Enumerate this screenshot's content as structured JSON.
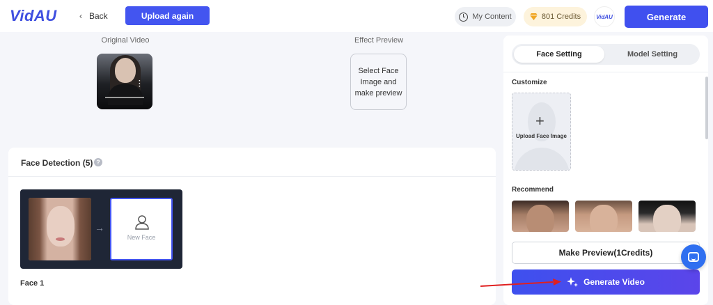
{
  "header": {
    "logo": "VidAU",
    "back_label": "Back",
    "upload_again_label": "Upload again",
    "my_content_label": "My Content",
    "credits_label": "801 Credits",
    "avatar_label": "VidAU",
    "generate_label": "Generate"
  },
  "preview": {
    "original_label": "Original Video",
    "effect_label": "Effect Preview",
    "effect_placeholder": "Select Face Image and make preview"
  },
  "face_detection": {
    "title": "Face Detection (5)",
    "help_glyph": "?",
    "new_face_label": "New Face",
    "face_name": "Face 1"
  },
  "panel": {
    "tabs": [
      {
        "label": "Face Setting",
        "active": true
      },
      {
        "label": "Model Setting",
        "active": false
      }
    ],
    "customize_label": "Customize",
    "upload_face_label": "Upload Face Image",
    "recommend_label": "Recommend",
    "make_preview_label": "Make Preview(1Credits)",
    "generate_video_label": "Generate Video"
  },
  "colors": {
    "accent": "#4355f0",
    "annotation": "#e02020"
  },
  "icons": [
    "chevron-left-icon",
    "clock-icon",
    "gem-icon",
    "help-icon",
    "arrow-right-icon",
    "user-icon",
    "plus-icon",
    "sparkle-icon",
    "chat-icon"
  ]
}
